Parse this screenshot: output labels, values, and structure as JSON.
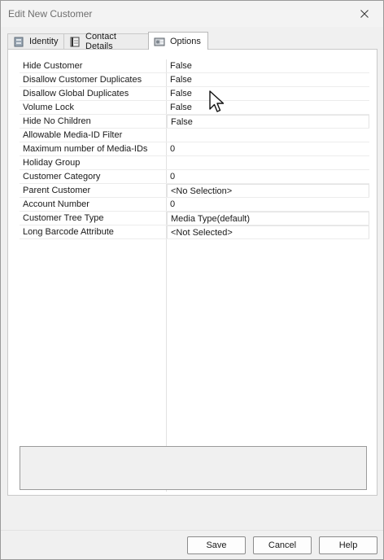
{
  "window": {
    "title": "Edit New Customer"
  },
  "tabs": [
    {
      "label": "Identity",
      "icon": "identity-icon",
      "active": false
    },
    {
      "label": "Contact Details",
      "icon": "contact-details-icon",
      "active": false
    },
    {
      "label": "Options",
      "icon": "options-icon",
      "active": true
    }
  ],
  "properties": [
    {
      "label": "Hide Customer",
      "value": "False"
    },
    {
      "label": "Disallow Customer Duplicates",
      "value": "False"
    },
    {
      "label": "Disallow Global Duplicates",
      "value": "False"
    },
    {
      "label": "Volume Lock",
      "value": "False"
    },
    {
      "label": "Hide No Children",
      "value": "False"
    },
    {
      "label": "Allowable Media-ID Filter",
      "value": ""
    },
    {
      "label": "Maximum number of Media-IDs",
      "value": "0"
    },
    {
      "label": "Holiday Group",
      "value": ""
    },
    {
      "label": "Customer Category",
      "value": "0"
    },
    {
      "label": "Parent Customer",
      "value": "<No Selection>"
    },
    {
      "label": "Account Number",
      "value": "0"
    },
    {
      "label": "Customer Tree Type",
      "value": "Media Type(default)"
    },
    {
      "label": "Long Barcode Attribute",
      "value": "<Not Selected>"
    }
  ],
  "buttons": {
    "save": "Save",
    "cancel": "Cancel",
    "help": "Help"
  }
}
